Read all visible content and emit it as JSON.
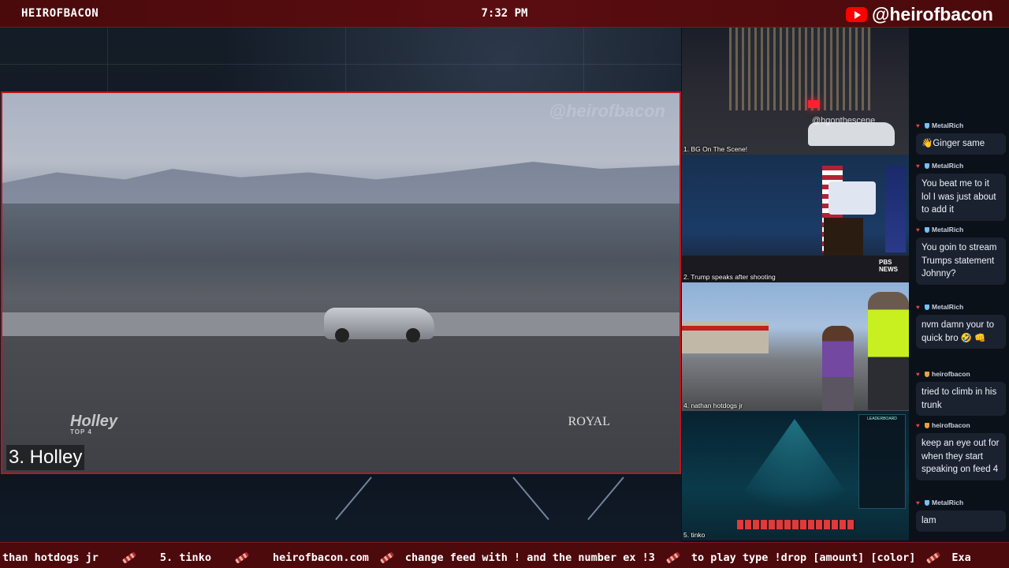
{
  "topbar": {
    "brand": "HEIROFBACON",
    "clock": "7:32 PM",
    "handle": "@heirofbacon",
    "handle_icon": "youtube-icon"
  },
  "main_feed": {
    "label": "3. Holley",
    "watermark": "@heirofbacon",
    "sponsor_left": "Holley",
    "sponsor_left_sub": "TOP 4",
    "sponsor_right": "ROYAL"
  },
  "feeds": [
    {
      "label": "1. BG On The Scene!",
      "overlay": "@bgonthescene"
    },
    {
      "label": "2. Trump speaks after shooting",
      "overlay": "PBS NEWS"
    },
    {
      "label": "4. nathan hotdogs jr"
    },
    {
      "label": "5. tinko",
      "overlay": "LEADERBOARD"
    }
  ],
  "chat": {
    "messages": [
      {
        "user": "MetalRich",
        "text": "👋Ginger same"
      },
      {
        "user": "MetalRich",
        "text": "You beat me to it lol I was just about to add it"
      },
      {
        "user": "MetalRich",
        "text": "You goin to stream Trumps statement Johnny?"
      },
      {
        "user": "MetalRich",
        "text": "nvm damn your to quick bro 🤣 👊"
      },
      {
        "user": "heirofbacon",
        "text": "tried to climb in his trunk"
      },
      {
        "user": "heirofbacon",
        "text": "keep an eye out for when they start speaking on feed 4"
      },
      {
        "user": "MetalRich",
        "text": "lam"
      }
    ]
  },
  "ticker": {
    "items": [
      "than hotdogs jr",
      "5. tinko",
      "heirofbacon.com",
      "change feed with ! and the number ex !3",
      "to play type !drop [amount] [color]",
      "Exa"
    ]
  },
  "colors": {
    "accent_red": "#c0151b",
    "topbar_bg": "#4a0a0c",
    "ticker_bg": "#4c0a0d",
    "chat_bubble": "#1a2230"
  }
}
